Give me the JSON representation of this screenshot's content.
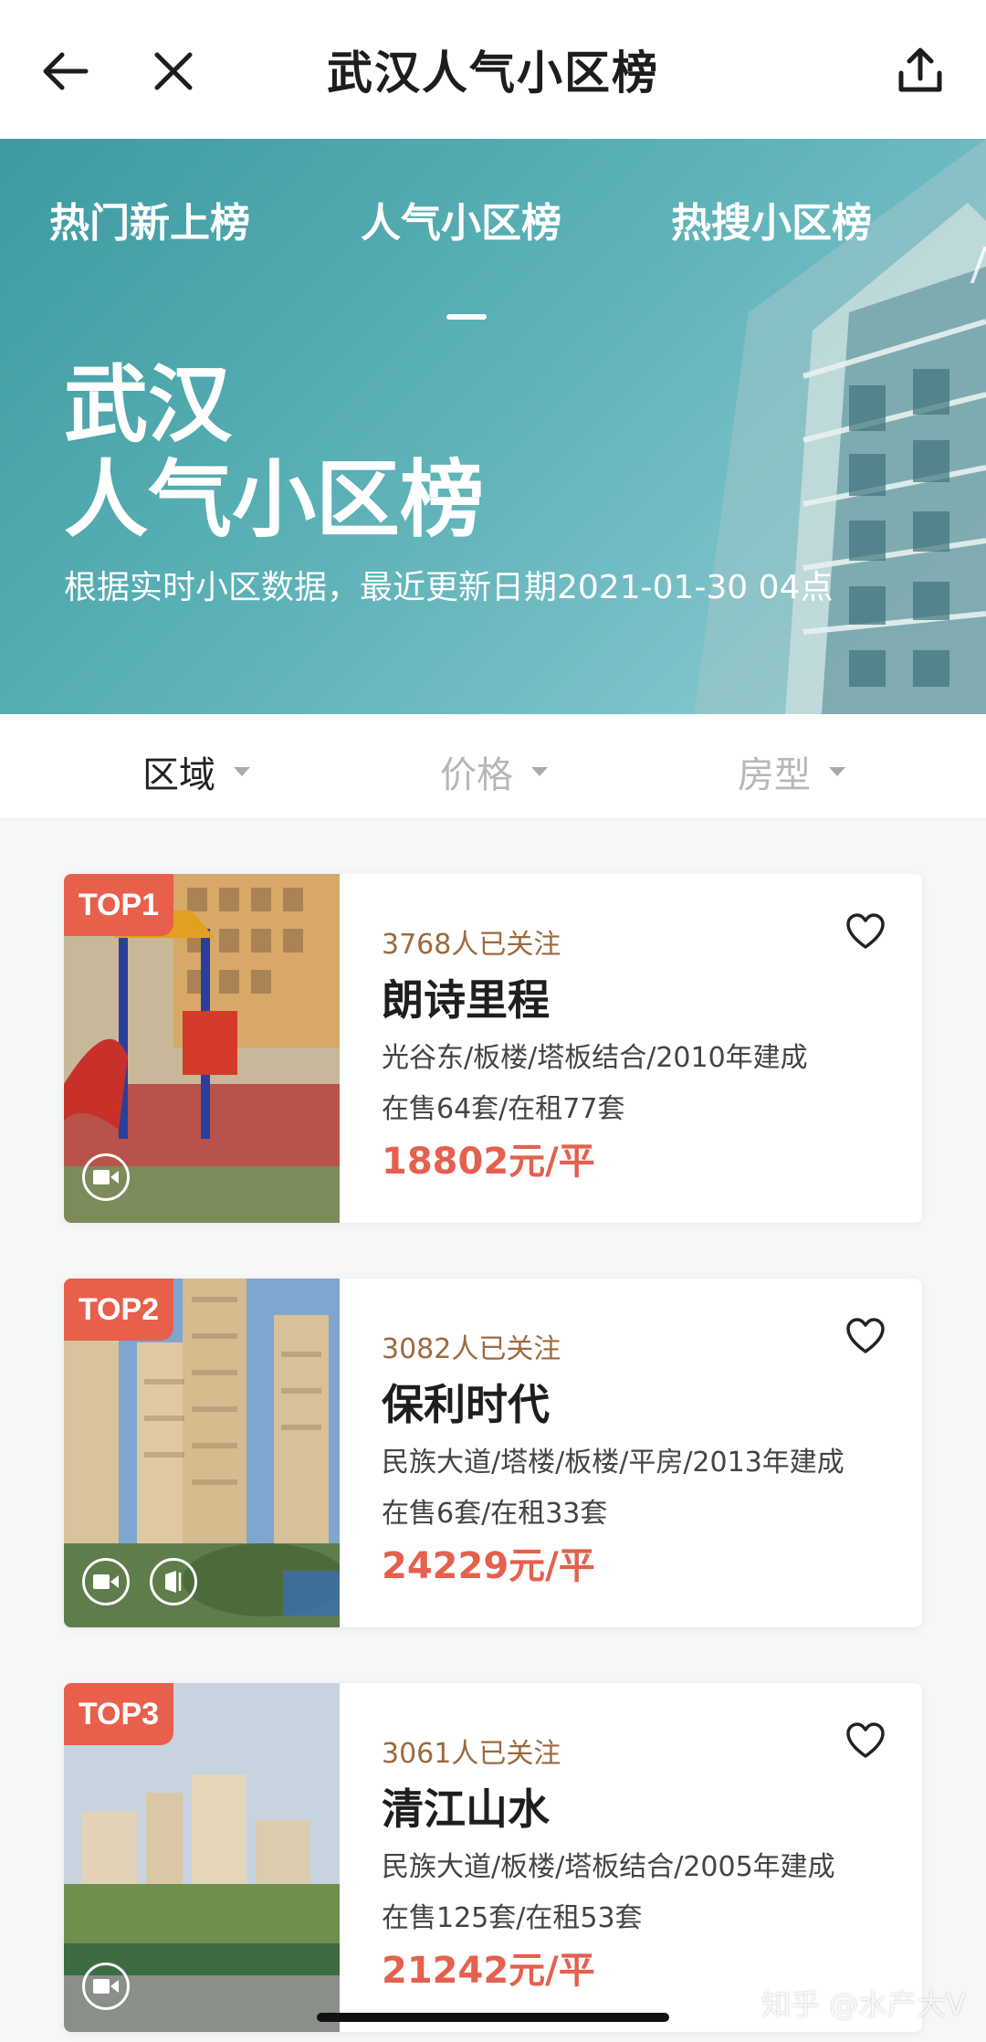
{
  "nav": {
    "title": "武汉人气小区榜",
    "back_icon": "arrow-left-icon",
    "close_icon": "close-icon",
    "share_icon": "share-icon"
  },
  "banner": {
    "tabs": [
      {
        "label": "热门新上榜"
      },
      {
        "label": "人气小区榜",
        "active": true
      },
      {
        "label": "热搜小区榜"
      }
    ],
    "city": "武汉",
    "name": "人气小区榜",
    "subtitle": "根据实时小区数据，最近更新日期2021-01-30 04点"
  },
  "filters": [
    {
      "label": "区域"
    },
    {
      "label": "价格"
    },
    {
      "label": "房型"
    }
  ],
  "listings": [
    {
      "rank": "TOP1",
      "followers": "3768人已关注",
      "name": "朗诗里程",
      "meta": "光谷东/板楼/塔板结合/2010年建成",
      "stock": "在售64套/在租77套",
      "price": "18802元/平",
      "media": [
        "video-icon"
      ]
    },
    {
      "rank": "TOP2",
      "followers": "3082人已关注",
      "name": "保利时代",
      "meta": "民族大道/塔楼/板楼/平房/2013年建成",
      "stock": "在售6套/在租33套",
      "price": "24229元/平",
      "media": [
        "video-icon",
        "vr-icon"
      ]
    },
    {
      "rank": "TOP3",
      "followers": "3061人已关注",
      "name": "清江山水",
      "meta": "民族大道/板楼/塔板结合/2005年建成",
      "stock": "在售125套/在租53套",
      "price": "21242元/平",
      "media": [
        "video-icon"
      ]
    }
  ],
  "watermark": "知乎 @水产大V",
  "colors": {
    "accent": "#e5604e",
    "rank_badge": "#e85f4c",
    "followers": "#9c6a3f",
    "banner": "#5bb1b6"
  }
}
